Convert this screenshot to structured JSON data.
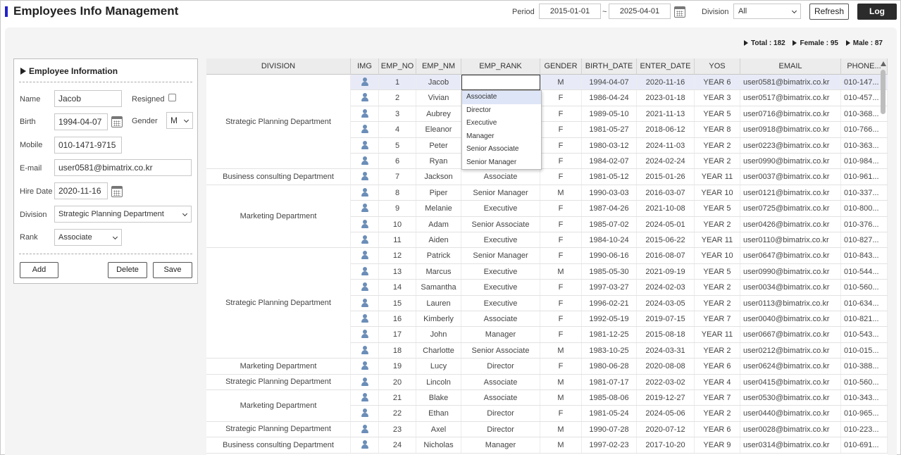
{
  "header": {
    "title": "Employees Info Management",
    "period_label": "Period",
    "period_from": "2015-01-01",
    "period_sep": "~",
    "period_to": "2025-04-01",
    "division_label": "Division",
    "division_value": "All",
    "refresh_label": "Refresh",
    "log_label": "Log"
  },
  "summary": {
    "total_label": "Total : 182",
    "female_label": "Female : 95",
    "male_label": "Male : 87"
  },
  "form": {
    "title": "Employee Information",
    "name_label": "Name",
    "name_value": "Jacob",
    "resigned_label": "Resigned",
    "birth_label": "Birth",
    "birth_value": "1994-04-07",
    "gender_label": "Gender",
    "gender_value": "M",
    "mobile_label": "Mobile",
    "mobile_value": "010-1471-9715",
    "email_label": "E-mail",
    "email_value": "user0581@bimatrix.co.kr",
    "hire_label": "Hire Date",
    "hire_value": "2020-11-16",
    "division_label": "Division",
    "division_value": "Strategic Planning Department",
    "rank_label": "Rank",
    "rank_value": "Associate",
    "add_label": "Add",
    "delete_label": "Delete",
    "save_label": "Save"
  },
  "grid": {
    "columns": [
      "DIVISION",
      "IMG",
      "EMP_NO",
      "EMP_NM",
      "EMP_RANK",
      "GENDER",
      "BIRTH_DATE",
      "ENTER_DATE",
      "YOS",
      "EMAIL",
      "PHONE..."
    ],
    "division_groups": [
      {
        "label": "Strategic Planning Department",
        "rows": 6
      },
      {
        "label": "Business consulting Department",
        "rows": 1
      },
      {
        "label": "Marketing Department",
        "rows": 4
      },
      {
        "label": "Strategic Planning Department",
        "rows": 7
      },
      {
        "label": "Marketing Department",
        "rows": 1
      },
      {
        "label": "Strategic Planning Department",
        "rows": 1
      },
      {
        "label": "Marketing Department",
        "rows": 2
      },
      {
        "label": "Strategic Planning Department",
        "rows": 1
      },
      {
        "label": "Business consulting Department",
        "rows": 1
      }
    ],
    "rows": [
      {
        "no": "1",
        "name": "Jacob",
        "rank": "",
        "gender": "M",
        "birth": "1994-04-07",
        "enter": "2020-11-16",
        "yos": "YEAR 6",
        "email": "user0581@bimatrix.co.kr",
        "phone": "010-147..."
      },
      {
        "no": "2",
        "name": "Vivian",
        "rank": "",
        "gender": "F",
        "birth": "1986-04-24",
        "enter": "2023-01-18",
        "yos": "YEAR 3",
        "email": "user0517@bimatrix.co.kr",
        "phone": "010-457..."
      },
      {
        "no": "3",
        "name": "Aubrey",
        "rank": "",
        "gender": "F",
        "birth": "1989-05-10",
        "enter": "2021-11-13",
        "yos": "YEAR 5",
        "email": "user0716@bimatrix.co.kr",
        "phone": "010-368..."
      },
      {
        "no": "4",
        "name": "Eleanor",
        "rank": "",
        "gender": "F",
        "birth": "1981-05-27",
        "enter": "2018-06-12",
        "yos": "YEAR 8",
        "email": "user0918@bimatrix.co.kr",
        "phone": "010-766..."
      },
      {
        "no": "5",
        "name": "Peter",
        "rank": "",
        "gender": "F",
        "birth": "1980-03-12",
        "enter": "2024-11-03",
        "yos": "YEAR 2",
        "email": "user0223@bimatrix.co.kr",
        "phone": "010-363..."
      },
      {
        "no": "6",
        "name": "Ryan",
        "rank": "",
        "gender": "F",
        "birth": "1984-02-07",
        "enter": "2024-02-24",
        "yos": "YEAR 2",
        "email": "user0990@bimatrix.co.kr",
        "phone": "010-984..."
      },
      {
        "no": "7",
        "name": "Jackson",
        "rank": "Associate",
        "gender": "F",
        "birth": "1981-05-12",
        "enter": "2015-01-26",
        "yos": "YEAR 11",
        "email": "user0037@bimatrix.co.kr",
        "phone": "010-961..."
      },
      {
        "no": "8",
        "name": "Piper",
        "rank": "Senior Manager",
        "gender": "M",
        "birth": "1990-03-03",
        "enter": "2016-03-07",
        "yos": "YEAR 10",
        "email": "user0121@bimatrix.co.kr",
        "phone": "010-337..."
      },
      {
        "no": "9",
        "name": "Melanie",
        "rank": "Executive",
        "gender": "F",
        "birth": "1987-04-26",
        "enter": "2021-10-08",
        "yos": "YEAR 5",
        "email": "user0725@bimatrix.co.kr",
        "phone": "010-800..."
      },
      {
        "no": "10",
        "name": "Adam",
        "rank": "Senior Associate",
        "gender": "F",
        "birth": "1985-07-02",
        "enter": "2024-05-01",
        "yos": "YEAR 2",
        "email": "user0426@bimatrix.co.kr",
        "phone": "010-376..."
      },
      {
        "no": "11",
        "name": "Aiden",
        "rank": "Executive",
        "gender": "F",
        "birth": "1984-10-24",
        "enter": "2015-06-22",
        "yos": "YEAR 11",
        "email": "user0110@bimatrix.co.kr",
        "phone": "010-827..."
      },
      {
        "no": "12",
        "name": "Patrick",
        "rank": "Senior Manager",
        "gender": "F",
        "birth": "1990-06-16",
        "enter": "2016-08-07",
        "yos": "YEAR 10",
        "email": "user0647@bimatrix.co.kr",
        "phone": "010-843..."
      },
      {
        "no": "13",
        "name": "Marcus",
        "rank": "Executive",
        "gender": "M",
        "birth": "1985-05-30",
        "enter": "2021-09-19",
        "yos": "YEAR 5",
        "email": "user0990@bimatrix.co.kr",
        "phone": "010-544..."
      },
      {
        "no": "14",
        "name": "Samantha",
        "rank": "Executive",
        "gender": "F",
        "birth": "1997-03-27",
        "enter": "2024-02-03",
        "yos": "YEAR 2",
        "email": "user0034@bimatrix.co.kr",
        "phone": "010-560..."
      },
      {
        "no": "15",
        "name": "Lauren",
        "rank": "Executive",
        "gender": "F",
        "birth": "1996-02-21",
        "enter": "2024-03-05",
        "yos": "YEAR 2",
        "email": "user0113@bimatrix.co.kr",
        "phone": "010-634..."
      },
      {
        "no": "16",
        "name": "Kimberly",
        "rank": "Associate",
        "gender": "F",
        "birth": "1992-05-19",
        "enter": "2019-07-15",
        "yos": "YEAR 7",
        "email": "user0040@bimatrix.co.kr",
        "phone": "010-821..."
      },
      {
        "no": "17",
        "name": "John",
        "rank": "Manager",
        "gender": "F",
        "birth": "1981-12-25",
        "enter": "2015-08-18",
        "yos": "YEAR 11",
        "email": "user0667@bimatrix.co.kr",
        "phone": "010-543..."
      },
      {
        "no": "18",
        "name": "Charlotte",
        "rank": "Senior Associate",
        "gender": "M",
        "birth": "1983-10-25",
        "enter": "2024-03-31",
        "yos": "YEAR 2",
        "email": "user0212@bimatrix.co.kr",
        "phone": "010-015..."
      },
      {
        "no": "19",
        "name": "Lucy",
        "rank": "Director",
        "gender": "F",
        "birth": "1980-06-28",
        "enter": "2020-08-08",
        "yos": "YEAR 6",
        "email": "user0624@bimatrix.co.kr",
        "phone": "010-388..."
      },
      {
        "no": "20",
        "name": "Lincoln",
        "rank": "Associate",
        "gender": "M",
        "birth": "1981-07-17",
        "enter": "2022-03-02",
        "yos": "YEAR 4",
        "email": "user0415@bimatrix.co.kr",
        "phone": "010-560..."
      },
      {
        "no": "21",
        "name": "Blake",
        "rank": "Associate",
        "gender": "M",
        "birth": "1985-08-06",
        "enter": "2019-12-27",
        "yos": "YEAR 7",
        "email": "user0530@bimatrix.co.kr",
        "phone": "010-343..."
      },
      {
        "no": "22",
        "name": "Ethan",
        "rank": "Director",
        "gender": "F",
        "birth": "1981-05-24",
        "enter": "2024-05-06",
        "yos": "YEAR 2",
        "email": "user0440@bimatrix.co.kr",
        "phone": "010-965..."
      },
      {
        "no": "23",
        "name": "Axel",
        "rank": "Director",
        "gender": "M",
        "birth": "1990-07-28",
        "enter": "2020-07-12",
        "yos": "YEAR 6",
        "email": "user0028@bimatrix.co.kr",
        "phone": "010-223..."
      },
      {
        "no": "24",
        "name": "Nicholas",
        "rank": "Manager",
        "gender": "M",
        "birth": "1997-02-23",
        "enter": "2017-10-20",
        "yos": "YEAR 9",
        "email": "user0314@bimatrix.co.kr",
        "phone": "010-691..."
      }
    ],
    "rank_options": [
      "Associate",
      "Director",
      "Executive",
      "Manager",
      "Senior Associate",
      "Senior Manager"
    ],
    "icons": {
      "img_column": "user-icon"
    }
  },
  "colors": {
    "accent": "#2222cc",
    "selected_row": "#e8ebf7",
    "header_bg": "#ececec",
    "log_button": "#2b2b2b"
  }
}
